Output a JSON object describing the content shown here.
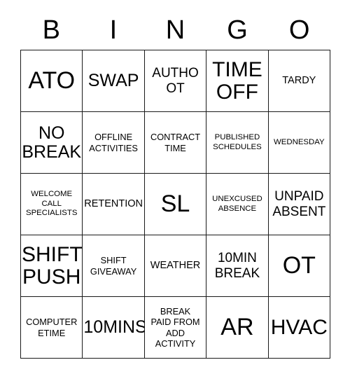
{
  "card": {
    "type": "bingo-card",
    "title_letters": [
      "B",
      "I",
      "N",
      "G",
      "O"
    ],
    "columns": 5,
    "rows": 5,
    "colors": {
      "background": "#ffffff",
      "text": "#000000",
      "border": "#1a1a1a"
    },
    "cells": [
      [
        {
          "text": "ATO",
          "size": "xxl"
        },
        {
          "text": "SWAP",
          "size": "lg"
        },
        {
          "text": "AUTHO\nOT",
          "size": "md"
        },
        {
          "text": "TIME\nOFF",
          "size": "xl"
        },
        {
          "text": "TARDY",
          "size": "sm"
        }
      ],
      [
        {
          "text": "NO\nBREAK",
          "size": "lg"
        },
        {
          "text": "OFFLINE\nACTIVITIES",
          "size": "xs"
        },
        {
          "text": "CONTRACT\nTIME",
          "size": "xs"
        },
        {
          "text": "PUBLISHED\nSCHEDULES",
          "size": "xxs"
        },
        {
          "text": "WEDNESDAY",
          "size": "xxs"
        }
      ],
      [
        {
          "text": "WELCOME\nCALL\nSPECIALISTS",
          "size": "xxs"
        },
        {
          "text": "RETENTION",
          "size": "sm"
        },
        {
          "text": "SL",
          "size": "xxl"
        },
        {
          "text": "UNEXCUSED\nABSENCE",
          "size": "xxs"
        },
        {
          "text": "UNPAID\nABSENT",
          "size": "md"
        }
      ],
      [
        {
          "text": "SHIFT\nPUSH",
          "size": "xl"
        },
        {
          "text": "SHIFT\nGIVEAWAY",
          "size": "xs"
        },
        {
          "text": "WEATHER",
          "size": "sm"
        },
        {
          "text": "10MIN\nBREAK",
          "size": "md"
        },
        {
          "text": "OT",
          "size": "xxl"
        }
      ],
      [
        {
          "text": "COMPUTER\nETIME",
          "size": "xs"
        },
        {
          "text": "10MINS",
          "size": "lg"
        },
        {
          "text": "BREAK\nPAID FROM\nADD\nACTIVITY",
          "size": "xs"
        },
        {
          "text": "AR",
          "size": "xxl"
        },
        {
          "text": "HVAC",
          "size": "xl"
        }
      ]
    ]
  }
}
